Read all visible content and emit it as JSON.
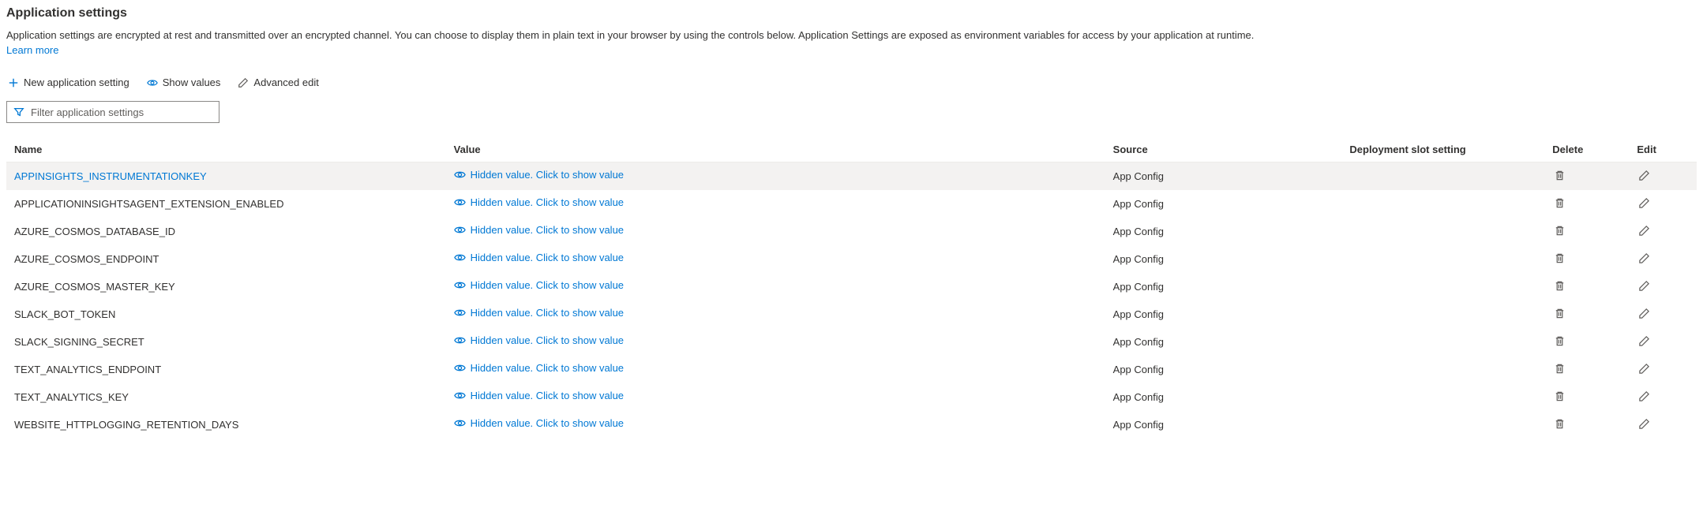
{
  "section": {
    "title": "Application settings",
    "description": "Application settings are encrypted at rest and transmitted over an encrypted channel. You can choose to display them in plain text in your browser by using the controls below. Application Settings are exposed as environment variables for access by your application at runtime.",
    "learn_more": "Learn more"
  },
  "toolbar": {
    "new_setting": "New application setting",
    "show_values": "Show values",
    "advanced_edit": "Advanced edit"
  },
  "filter": {
    "placeholder": "Filter application settings"
  },
  "table": {
    "headers": {
      "name": "Name",
      "value": "Value",
      "source": "Source",
      "slot": "Deployment slot setting",
      "delete": "Delete",
      "edit": "Edit"
    },
    "hidden_value_text": "Hidden value. Click to show value",
    "rows": [
      {
        "name": "APPINSIGHTS_INSTRUMENTATIONKEY",
        "source": "App Config",
        "hover": true
      },
      {
        "name": "APPLICATIONINSIGHTSAGENT_EXTENSION_ENABLED",
        "source": "App Config",
        "hover": false
      },
      {
        "name": "AZURE_COSMOS_DATABASE_ID",
        "source": "App Config",
        "hover": false
      },
      {
        "name": "AZURE_COSMOS_ENDPOINT",
        "source": "App Config",
        "hover": false
      },
      {
        "name": "AZURE_COSMOS_MASTER_KEY",
        "source": "App Config",
        "hover": false
      },
      {
        "name": "SLACK_BOT_TOKEN",
        "source": "App Config",
        "hover": false
      },
      {
        "name": "SLACK_SIGNING_SECRET",
        "source": "App Config",
        "hover": false
      },
      {
        "name": "TEXT_ANALYTICS_ENDPOINT",
        "source": "App Config",
        "hover": false
      },
      {
        "name": "TEXT_ANALYTICS_KEY",
        "source": "App Config",
        "hover": false
      },
      {
        "name": "WEBSITE_HTTPLOGGING_RETENTION_DAYS",
        "source": "App Config",
        "hover": false
      }
    ]
  }
}
